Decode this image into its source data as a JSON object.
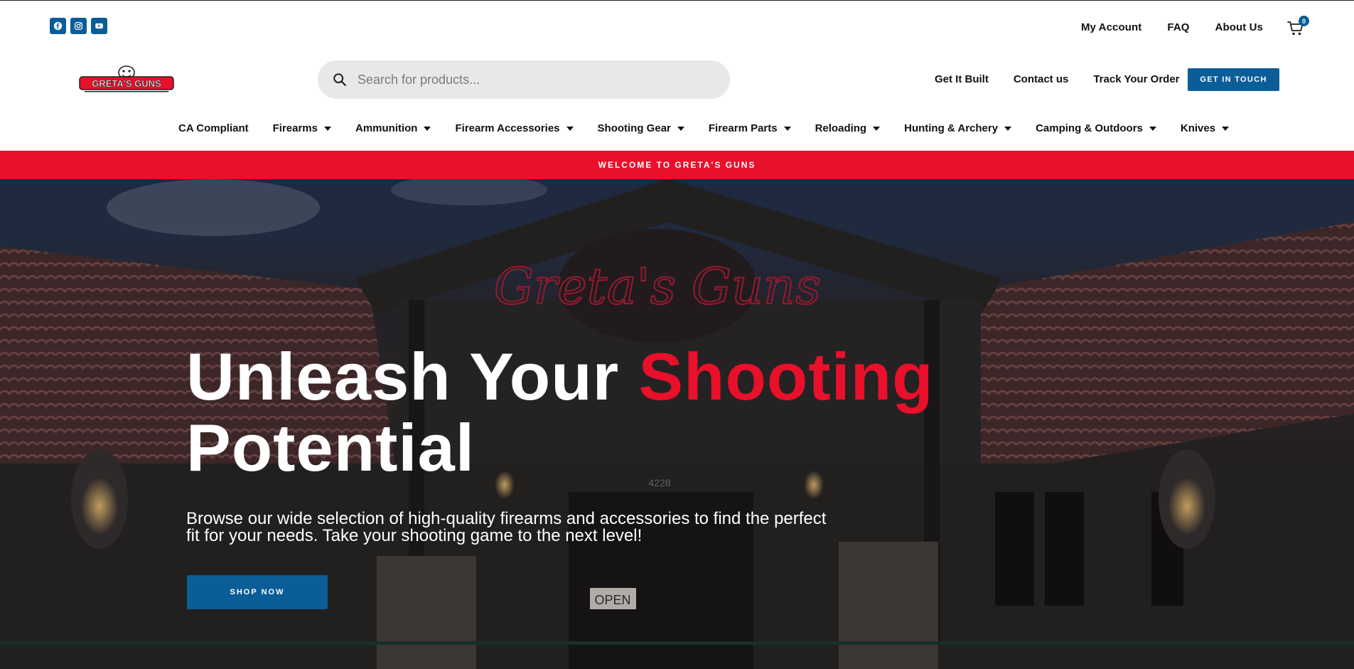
{
  "social": {
    "items": [
      {
        "icon": "facebook-icon",
        "label": "f"
      },
      {
        "icon": "instagram-icon",
        "label": "ig"
      },
      {
        "icon": "youtube-icon",
        "label": "yt"
      }
    ]
  },
  "utility_nav": {
    "my_account": "My Account",
    "faq": "FAQ",
    "about_us": "About Us"
  },
  "cart": {
    "count": "0"
  },
  "logo": {
    "text": "GRETA'S GUNS"
  },
  "search": {
    "placeholder": "Search for products..."
  },
  "secondary_nav": {
    "get_it_built": "Get It Built",
    "contact_us": "Contact us",
    "track_order": "Track Your Order",
    "cta_label": "GET IN TOUCH"
  },
  "main_nav": {
    "ca_compliant": "CA Compliant",
    "firearms": "Firearms",
    "ammunition": "Ammunition",
    "firearm_accessories": "Firearm Accessories",
    "shooting_gear": "Shooting Gear",
    "firearm_parts": "Firearm Parts",
    "reloading": "Reloading",
    "hunting_archery": "Hunting & Archery",
    "camping_outdoors": "Camping & Outdoors",
    "knives": "Knives"
  },
  "welcome_bar": {
    "text": "WELCOME TO GRETA'S GUNS"
  },
  "hero": {
    "title_part1": "Unleash Your ",
    "title_accent": "Shooting",
    "title_part2": "Potential",
    "subtitle_line1": "Browse our wide selection of high-quality firearms and accessories to find the perfect",
    "subtitle_line2": "fit for your needs. Take your shooting game to the next level!",
    "button_label": "SHOP NOW",
    "sign_text": "Greta's Guns",
    "door_sign": "OPEN",
    "address_number": "4228"
  },
  "colors": {
    "brand_blue": "#0b5d97",
    "brand_red": "#e8102a",
    "text_dark": "#111111",
    "search_bg": "#e8e8e8"
  }
}
